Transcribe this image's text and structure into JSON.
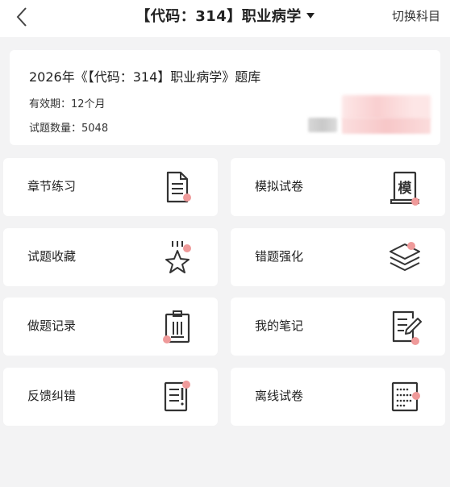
{
  "header": {
    "title": "【代码：314】职业病学",
    "switch_label": "切换科目"
  },
  "bank": {
    "title": "2026年《【代码：314】职业病学》题库",
    "validity": "有效期：12个月",
    "count": "试题数量：5048"
  },
  "tiles": [
    {
      "label": "章节练习",
      "icon": "document-icon"
    },
    {
      "label": "模拟试卷",
      "icon": "scroll-exam-icon"
    },
    {
      "label": "试题收藏",
      "icon": "star-icon"
    },
    {
      "label": "错题强化",
      "icon": "layers-icon"
    },
    {
      "label": "做题记录",
      "icon": "clipboard-icon"
    },
    {
      "label": "我的笔记",
      "icon": "note-edit-icon"
    },
    {
      "label": "反馈纠错",
      "icon": "feedback-icon"
    },
    {
      "label": "离线试卷",
      "icon": "offline-paper-icon"
    }
  ],
  "colors": {
    "accent_dot": "#ef9a9a",
    "icon_stroke": "#333333",
    "background": "#f3f3f4"
  }
}
